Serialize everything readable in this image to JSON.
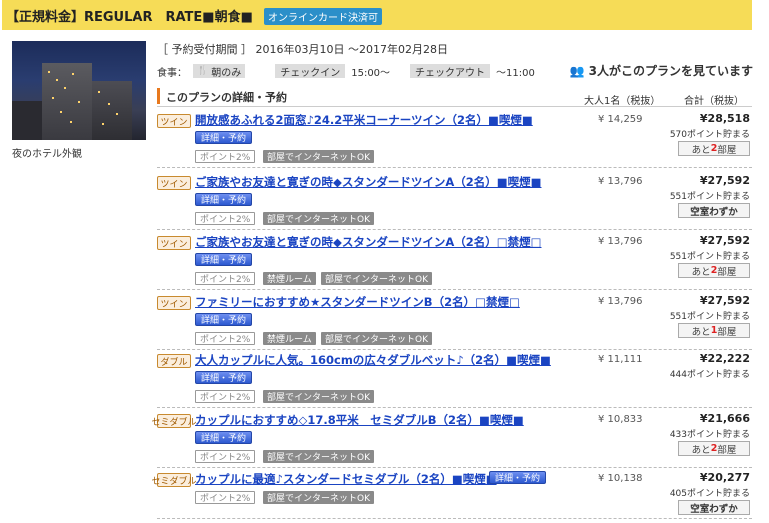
{
  "header": {
    "plan_title": "【正規料金】REGULAR　RATE■朝食■",
    "card_badge": "オンラインカード決済可"
  },
  "hotel": {
    "photo_caption": "夜のホテル外観"
  },
  "plan_info": {
    "period": "［ 予約受付期間 ］ 2016年03月10日 〜2017年02月28日",
    "meal_label": "食事：",
    "meal_value": "朝のみ",
    "checkin_label": "チェックイン",
    "checkin_value": "15:00〜",
    "checkout_label": "チェックアウト",
    "checkout_value": "〜11:00",
    "viewers": "3人がこのプランを見ています"
  },
  "details": {
    "heading": "このプランの詳細・予約",
    "col_adult": "大人1名（税抜）",
    "col_total": "合計（税抜）"
  },
  "colors": {
    "header_bg": "#f6dc57",
    "link": "#1a44c2",
    "accent": "#e8791e",
    "book_btn": "#2c59d0"
  },
  "rooms": [
    {
      "type": "ツイン",
      "name": "開放感あふれる2面窓♪24.2平米コーナーツイン（2名）■喫煙■",
      "book": "詳細・予約",
      "points_tag": "ポイント2%",
      "features": [
        "部屋でインターネットOK"
      ],
      "adult_price": "¥ 14,259",
      "total": "¥28,518",
      "points": "570ポイント貯まる",
      "avail_pre": "あと",
      "avail_num": "2",
      "avail_post": "部屋"
    },
    {
      "type": "ツイン",
      "name": "ご家族やお友達と寛ぎの時◆スタンダードツインA（2名）■喫煙■",
      "book": "詳細・予約",
      "points_tag": "ポイント2%",
      "features": [
        "部屋でインターネットOK"
      ],
      "adult_price": "¥ 13,796",
      "total": "¥27,592",
      "points": "551ポイント貯まる",
      "avail_text": "空室わずか"
    },
    {
      "type": "ツイン",
      "name": "ご家族やお友達と寛ぎの時◆スタンダードツインA（2名）□禁煙□",
      "book": "詳細・予約",
      "points_tag": "ポイント2%",
      "features": [
        "禁煙ルーム",
        "部屋でインターネットOK"
      ],
      "adult_price": "¥ 13,796",
      "total": "¥27,592",
      "points": "551ポイント貯まる",
      "avail_pre": "あと",
      "avail_num": "2",
      "avail_post": "部屋"
    },
    {
      "type": "ツイン",
      "name": "ファミリーにおすすめ★スタンダードツインB（2名）□禁煙□",
      "book": "詳細・予約",
      "points_tag": "ポイント2%",
      "features": [
        "禁煙ルーム",
        "部屋でインターネットOK"
      ],
      "adult_price": "¥ 13,796",
      "total": "¥27,592",
      "points": "551ポイント貯まる",
      "avail_pre": "あと",
      "avail_num": "1",
      "avail_post": "部屋"
    },
    {
      "type": "ダブル",
      "name": "大人カップルに人気。160cmの広々ダブルベット♪（2名）■喫煙■",
      "book": "詳細・予約",
      "points_tag": "ポイント2%",
      "features": [
        "部屋でインターネットOK"
      ],
      "adult_price": "¥ 11,111",
      "total": "¥22,222",
      "points": "444ポイント貯まる"
    },
    {
      "type": "セミダブル",
      "name": "カップルにおすすめ◇17.8平米　セミダブルB（2名）■喫煙■",
      "book": "詳細・予約",
      "points_tag": "ポイント2%",
      "features": [
        "部屋でインターネットOK"
      ],
      "adult_price": "¥ 10,833",
      "total": "¥21,666",
      "points": "433ポイント貯まる",
      "avail_pre": "あと",
      "avail_num": "2",
      "avail_post": "部屋"
    },
    {
      "type": "セミダブル",
      "name": "カップルに最適♪スタンダードセミダブル（2名）■喫煙■",
      "book": "詳細・予約",
      "points_tag": "ポイント2%",
      "features": [
        "部屋でインターネットOK"
      ],
      "adult_price": "¥ 10,138",
      "total": "¥20,277",
      "points": "405ポイント貯まる",
      "avail_text": "空室わずか"
    }
  ]
}
